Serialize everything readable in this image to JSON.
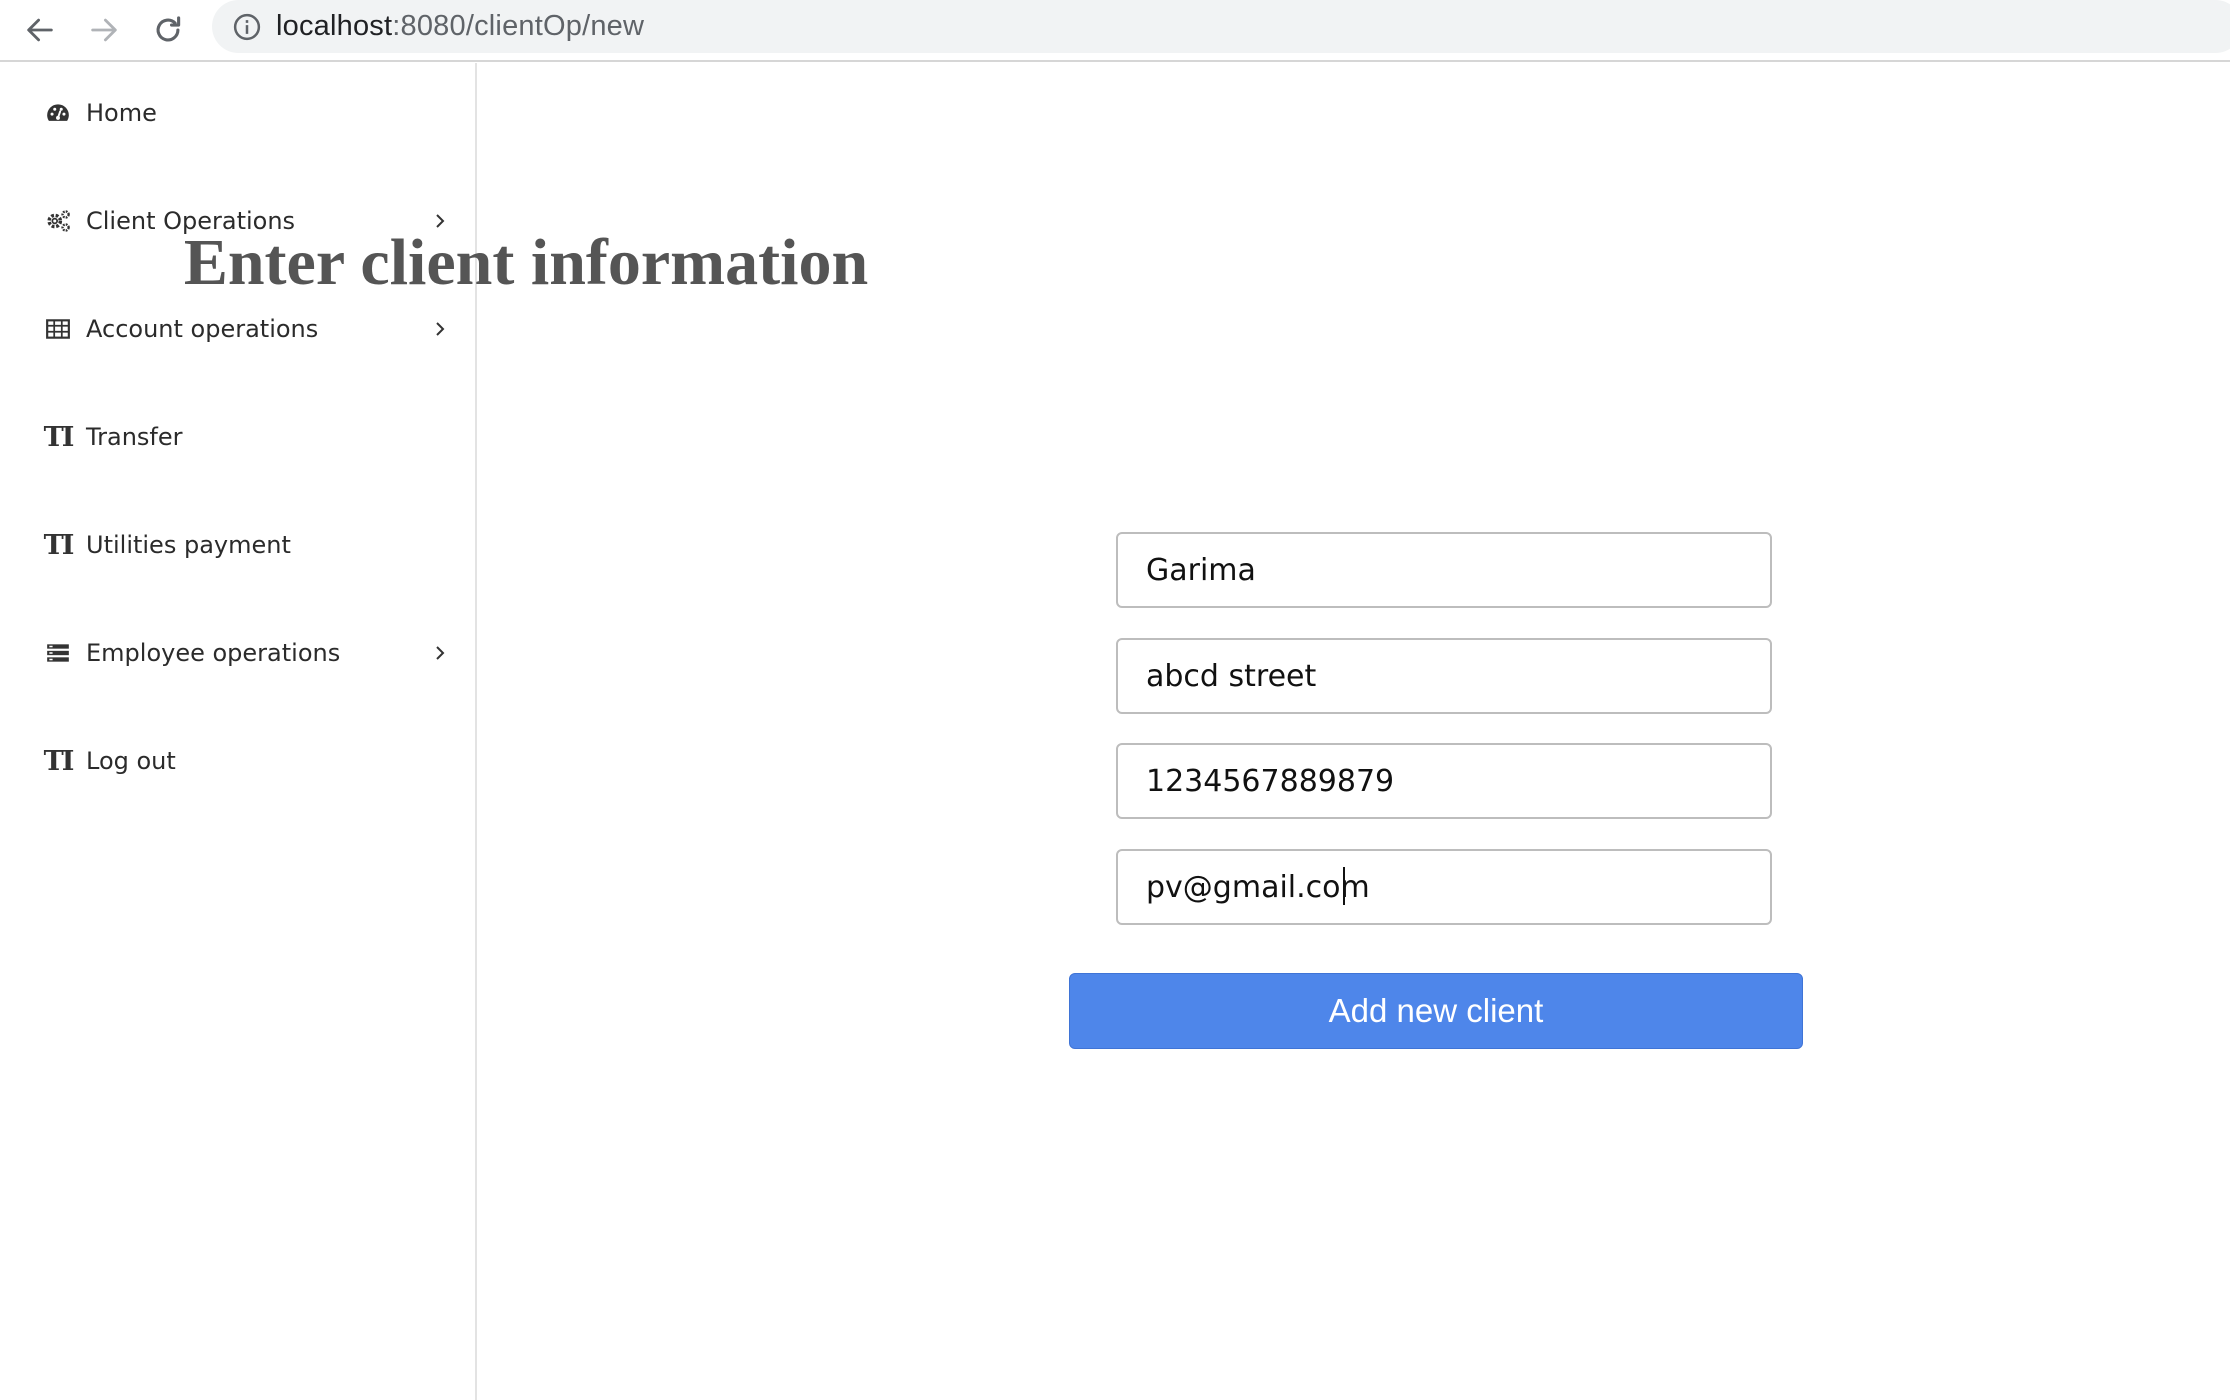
{
  "browser": {
    "url_host": "localhost",
    "url_path": ":8080/clientOp/new",
    "icons": [
      "back-arrow-icon",
      "forward-arrow-icon",
      "reload-icon",
      "info-icon"
    ]
  },
  "sidebar": {
    "items": [
      {
        "label": "Home",
        "icon": "dashboard-icon",
        "has_submenu": false
      },
      {
        "label": "Client Operations",
        "icon": "gears-icon",
        "has_submenu": true
      },
      {
        "label": "Account operations",
        "icon": "table-icon",
        "has_submenu": true
      },
      {
        "label": "Transfer",
        "icon": "text-height-icon",
        "has_submenu": false
      },
      {
        "label": "Utilities payment",
        "icon": "text-height-icon",
        "has_submenu": false
      },
      {
        "label": "Employee operations",
        "icon": "list-icon",
        "has_submenu": true
      },
      {
        "label": "Log out",
        "icon": "text-height-icon",
        "has_submenu": false
      }
    ],
    "glyph": "TI"
  },
  "main": {
    "title": "Enter client information",
    "fields": {
      "name": "Garima",
      "address": "abcd street",
      "phone": "1234567889879",
      "email": "pv@gmail.com"
    },
    "submit_label": "Add new client"
  },
  "colors": {
    "button": "#4e86ea",
    "title": "#555555"
  }
}
